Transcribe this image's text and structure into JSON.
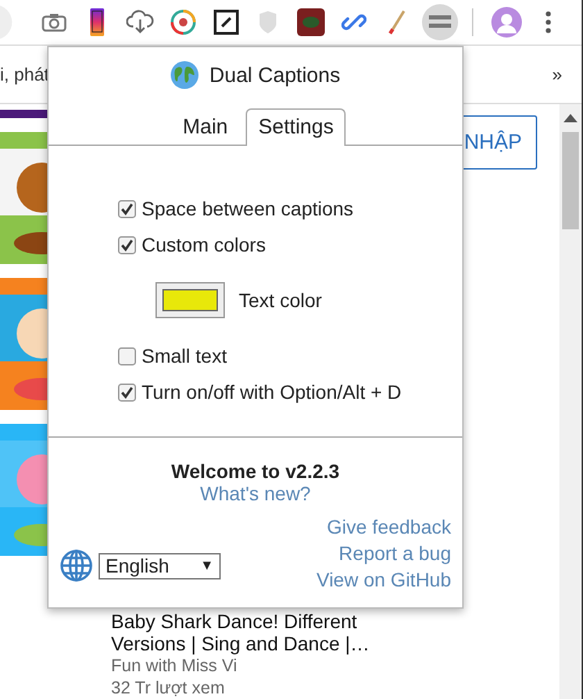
{
  "background_page": {
    "bookmarks_text": "i, phát",
    "overflow_button": "»",
    "sign_in_button": "NHẬP",
    "video": {
      "title_lines": [
        "Baby Shark Dance! Different",
        "Versions | Sing and Dance |…"
      ],
      "channel": "Fun with Miss Vi",
      "views": "32 Tr lượt xem"
    }
  },
  "popup": {
    "title": "Dual Captions",
    "tabs": [
      {
        "label": "Main",
        "selected": false
      },
      {
        "label": "Settings",
        "selected": true
      }
    ],
    "settings": [
      {
        "kind": "checkbox",
        "label": "Space between captions",
        "checked": true
      },
      {
        "kind": "checkbox",
        "label": "Custom colors",
        "checked": true
      },
      {
        "kind": "color",
        "label": "Text color",
        "color": "#e8e80a"
      },
      {
        "kind": "checkbox",
        "label": "Small text",
        "checked": false
      },
      {
        "kind": "checkbox",
        "label": "Turn on/off with Option/Alt + D",
        "checked": true
      }
    ],
    "welcome": "Welcome to v2.2.3",
    "whats_new": "What's new?",
    "language": "English",
    "dropdown_arrow": "▼",
    "links": [
      "Give feedback",
      "Report a bug",
      "View on GitHub"
    ]
  }
}
